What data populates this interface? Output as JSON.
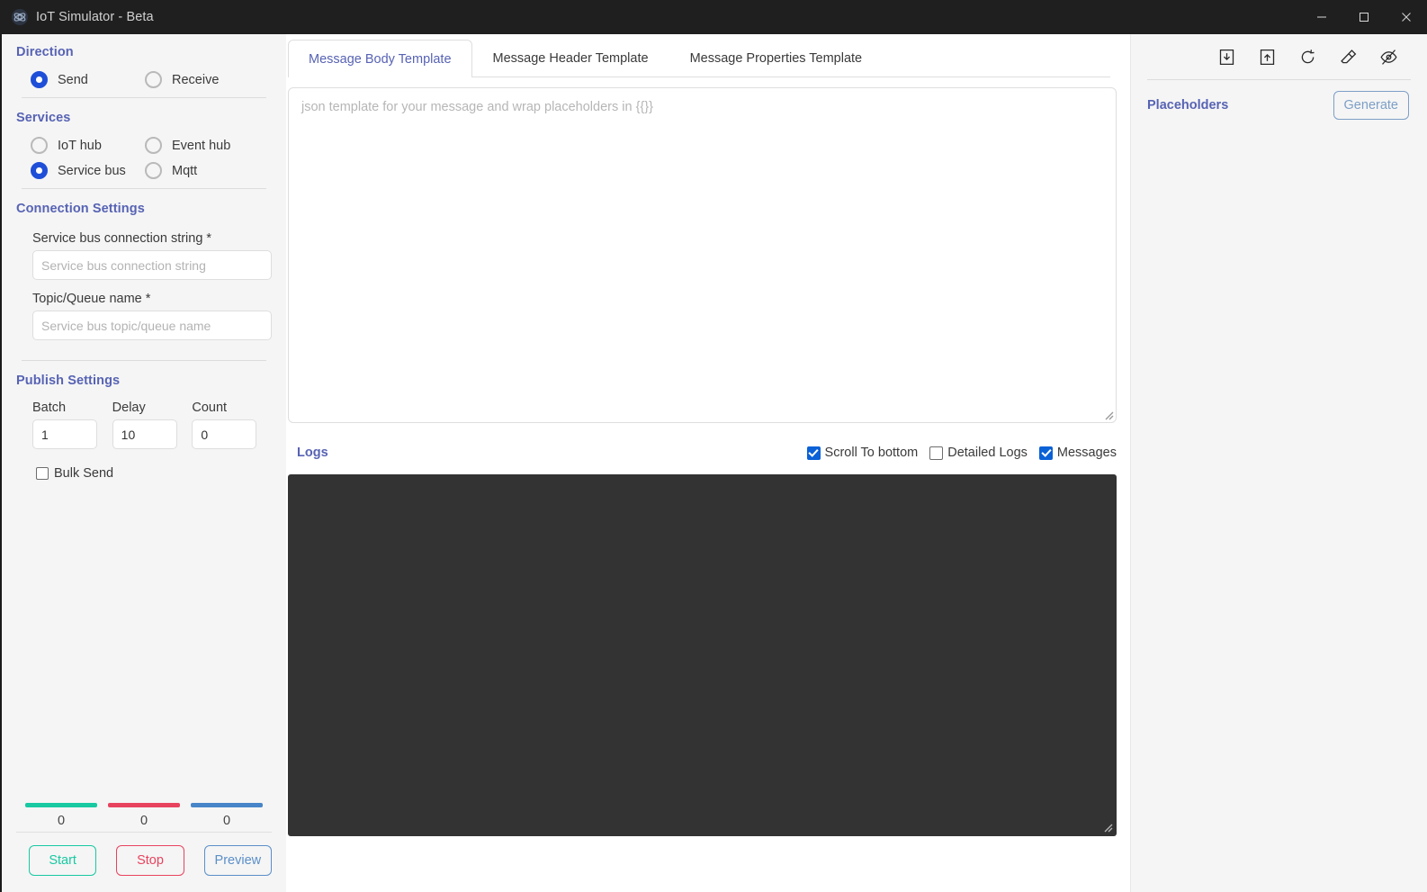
{
  "window": {
    "title": "IoT Simulator - Beta",
    "app_icon": "atom-icon",
    "minimize_label": "—",
    "maximize_label": "□",
    "close_label": "✕"
  },
  "sidebar": {
    "direction": {
      "heading": "Direction",
      "options": [
        {
          "label": "Send",
          "selected": true
        },
        {
          "label": "Receive",
          "selected": false
        }
      ]
    },
    "services": {
      "heading": "Services",
      "options": [
        {
          "label": "IoT hub",
          "selected": false
        },
        {
          "label": "Event hub",
          "selected": false
        },
        {
          "label": "Service bus",
          "selected": true
        },
        {
          "label": "Mqtt",
          "selected": false
        }
      ]
    },
    "connection": {
      "heading": "Connection Settings",
      "fields": [
        {
          "label": "Service bus connection string *",
          "value": "",
          "placeholder": "Service bus connection string"
        },
        {
          "label": "Topic/Queue name *",
          "value": "",
          "placeholder": "Service bus topic/queue name"
        }
      ]
    },
    "publish": {
      "heading": "Publish Settings",
      "fields": [
        {
          "label": "Batch",
          "value": "1"
        },
        {
          "label": "Delay",
          "value": "10"
        },
        {
          "label": "Count",
          "value": "0"
        }
      ],
      "bulk_send": {
        "label": "Bulk Send",
        "checked": false
      }
    },
    "stats": [
      {
        "value": "0",
        "color": "#18c9a2"
      },
      {
        "value": "0",
        "color": "#e8435e"
      },
      {
        "value": "0",
        "color": "#4785c8"
      }
    ],
    "actions": [
      {
        "label": "Start",
        "color": "#18c9a2"
      },
      {
        "label": "Stop",
        "color": "#e8435e"
      },
      {
        "label": "Preview",
        "color": "#5b8fc9"
      }
    ]
  },
  "main": {
    "tabs": [
      {
        "label": "Message Body Template",
        "active": true
      },
      {
        "label": "Message Header Template",
        "active": false
      },
      {
        "label": "Message Properties Template",
        "active": false
      }
    ],
    "template_editor": {
      "value": "",
      "placeholder": "json template for your message and wrap placeholders in {{}}"
    },
    "logs": {
      "title": "Logs",
      "content": "",
      "checkboxes": [
        {
          "label": "Scroll To bottom",
          "checked": true
        },
        {
          "label": "Detailed Logs",
          "checked": false
        },
        {
          "label": "Messages",
          "checked": true
        }
      ]
    }
  },
  "right_panel": {
    "toolbar": [
      {
        "icon": "download-icon"
      },
      {
        "icon": "upload-icon"
      },
      {
        "icon": "refresh-icon"
      },
      {
        "icon": "eraser-icon"
      },
      {
        "icon": "eye-off-icon"
      }
    ],
    "title": "Placeholders",
    "generate_label": "Generate"
  },
  "colors": {
    "heading": "#5763b4",
    "accent_blue": "#1f4fd8",
    "checkbox_blue": "#0b61d6",
    "titlebar_bg": "#1f1f1f",
    "log_bg": "#333333",
    "sidebar_bg": "#f5f5f5"
  }
}
